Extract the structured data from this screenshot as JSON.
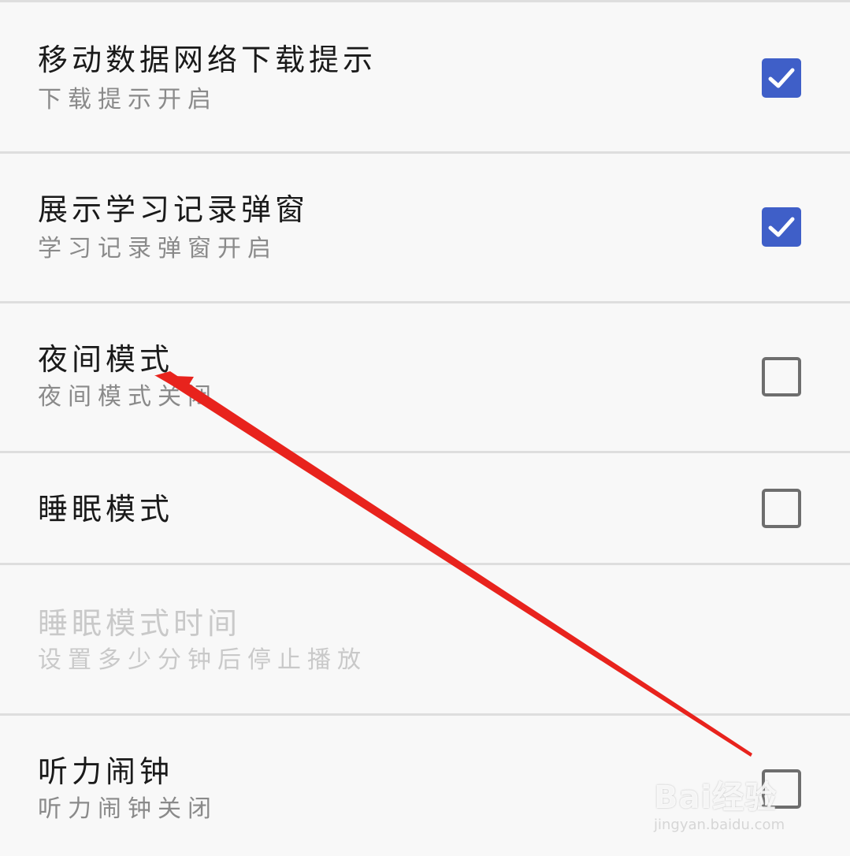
{
  "settings": {
    "items": [
      {
        "title": "移动数据网络下载提示",
        "subtitle": "下载提示开启",
        "checked": true,
        "enabled": true
      },
      {
        "title": "展示学习记录弹窗",
        "subtitle": "学习记录弹窗开启",
        "checked": true,
        "enabled": true
      },
      {
        "title": "夜间模式",
        "subtitle": "夜间模式关闭",
        "checked": false,
        "enabled": true
      },
      {
        "title": "睡眠模式",
        "subtitle": "",
        "checked": false,
        "enabled": true
      },
      {
        "title": "睡眠模式时间",
        "subtitle": "设置多少分钟后停止播放",
        "enabled": false
      },
      {
        "title": "听力闹钟",
        "subtitle": "听力闹钟关闭",
        "checked": false,
        "enabled": true
      }
    ]
  },
  "colors": {
    "checkbox_checked": "#3f5fc8",
    "checkbox_unchecked_border": "#6e6e6e",
    "annotation_arrow": "#e8231d"
  },
  "annotation": {
    "icon": "red-arrow-icon"
  },
  "watermark": {
    "logo": "Bai经验",
    "url": "jingyan.baidu.com"
  }
}
